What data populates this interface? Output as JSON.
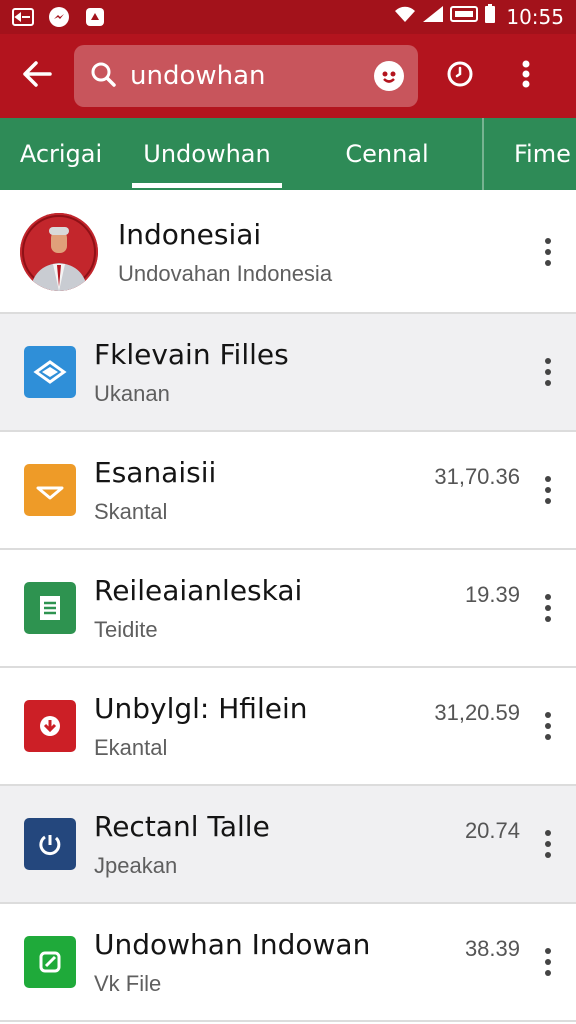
{
  "status_bar": {
    "time": "10:55",
    "icons": [
      "notification-icon",
      "messenger-icon",
      "app-icon",
      "wifi-icon",
      "signal-icon",
      "sim-icon",
      "battery-icon"
    ]
  },
  "app_bar": {
    "back_icon": "back-arrow-icon",
    "search_icon": "search-icon",
    "search_value": "undowhan",
    "voice_icon": "voice-icon",
    "history_icon": "history-icon",
    "more_icon": "more-vert-icon"
  },
  "tabs": [
    {
      "label": "Acrigai",
      "active": false
    },
    {
      "label": "Undowhan",
      "active": true
    },
    {
      "label": "Cennal",
      "active": false
    },
    {
      "label": "Fime",
      "active": false
    }
  ],
  "list": {
    "items": [
      {
        "title": "Indonesiai",
        "subtitle": "Undovahan Indonesia",
        "size": "",
        "icon": "person-avatar"
      },
      {
        "title": "Fklevain Filles",
        "subtitle": "Ukanan",
        "size": "",
        "icon": "blue-file-icon"
      },
      {
        "title": "Esanaisii",
        "subtitle": "Skantal",
        "size": "31,70.36",
        "icon": "orange-file-icon"
      },
      {
        "title": "Reileaianleskai",
        "subtitle": "Teidite",
        "size": "19.39",
        "icon": "green-doc-icon"
      },
      {
        "title": "Unbylgl: Hfilein",
        "subtitle": "Ekantal",
        "size": "31,20.59",
        "icon": "red-file-icon"
      },
      {
        "title": "Rectanl Talle",
        "subtitle": "Jpeakan",
        "size": "20.74",
        "icon": "navy-file-icon"
      },
      {
        "title": "Undowhan Indowan",
        "subtitle": "Vk File",
        "size": "38.39",
        "icon": "green-edit-icon"
      }
    ]
  },
  "colors": {
    "app_bar": "#b3141e",
    "status_bar": "#a3121b",
    "tab_bar": "#2e8b57",
    "blue": "#2f8fd8",
    "orange": "#ee9b28",
    "green": "#2e9350",
    "red": "#cc1f26",
    "navy": "#24477d",
    "bright_green": "#1faa3a"
  }
}
